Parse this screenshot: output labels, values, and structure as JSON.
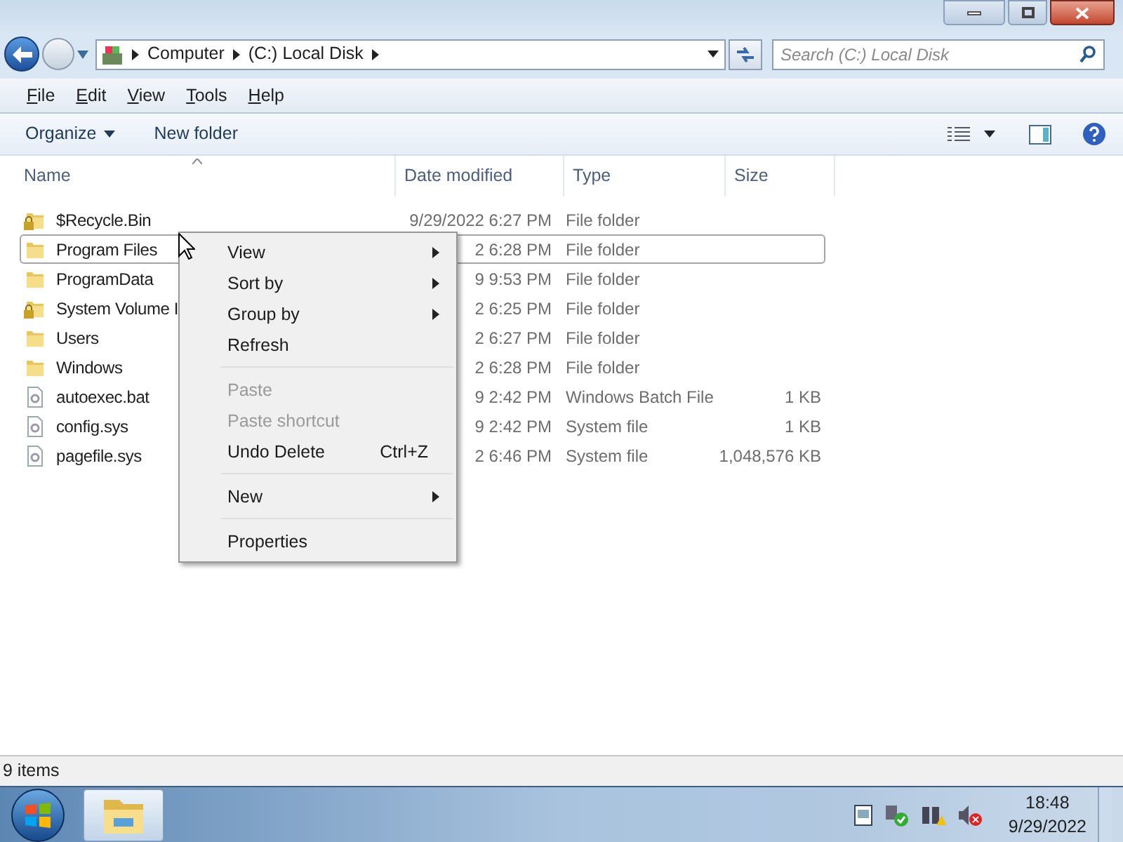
{
  "breadcrumb": [
    "Computer",
    "(C:) Local Disk"
  ],
  "search": {
    "placeholder": "Search (C:) Local Disk"
  },
  "menu_bar": [
    "File",
    "Edit",
    "View",
    "Tools",
    "Help"
  ],
  "command_bar": {
    "organize": "Organize",
    "new_folder": "New folder"
  },
  "table": {
    "columns": [
      "Name",
      "Date modified",
      "Type",
      "Size"
    ],
    "rows": [
      {
        "kind": "locked-folder",
        "name": "$Recycle.Bin",
        "date": "9/29/2022 6:27 PM",
        "type": "File folder",
        "size": "",
        "selected": false
      },
      {
        "kind": "folder",
        "name": "Program Files",
        "date": "2 6:28 PM",
        "type": "File folder",
        "size": "",
        "selected": true
      },
      {
        "kind": "folder",
        "name": "ProgramData",
        "date": "9 9:53 PM",
        "type": "File folder",
        "size": "",
        "selected": false
      },
      {
        "kind": "locked-folder",
        "name": "System Volume I",
        "date": "2 6:25 PM",
        "type": "File folder",
        "size": "",
        "selected": false
      },
      {
        "kind": "folder",
        "name": "Users",
        "date": "2 6:27 PM",
        "type": "File folder",
        "size": "",
        "selected": false
      },
      {
        "kind": "folder",
        "name": "Windows",
        "date": "2 6:28 PM",
        "type": "File folder",
        "size": "",
        "selected": false
      },
      {
        "kind": "batch",
        "name": "autoexec.bat",
        "date": "9 2:42 PM",
        "type": "Windows Batch File",
        "size": "1 KB",
        "selected": false
      },
      {
        "kind": "system",
        "name": "config.sys",
        "date": "9 2:42 PM",
        "type": "System file",
        "size": "1 KB",
        "selected": false
      },
      {
        "kind": "system",
        "name": "pagefile.sys",
        "date": "2 6:46 PM",
        "type": "System file",
        "size": "1,048,576 KB",
        "selected": false
      }
    ]
  },
  "context_menu": [
    {
      "kind": "item",
      "label": "View",
      "submenu": true,
      "disabled": false
    },
    {
      "kind": "item",
      "label": "Sort by",
      "submenu": true,
      "disabled": false
    },
    {
      "kind": "item",
      "label": "Group by",
      "submenu": true,
      "disabled": false
    },
    {
      "kind": "item",
      "label": "Refresh",
      "submenu": false,
      "disabled": false
    },
    {
      "kind": "separator"
    },
    {
      "kind": "item",
      "label": "Paste",
      "submenu": false,
      "disabled": true
    },
    {
      "kind": "item",
      "label": "Paste shortcut",
      "submenu": false,
      "disabled": true
    },
    {
      "kind": "item",
      "label": "Undo Delete",
      "shortcut": "Ctrl+Z",
      "submenu": false,
      "disabled": false
    },
    {
      "kind": "separator"
    },
    {
      "kind": "item",
      "label": "New",
      "submenu": true,
      "disabled": false
    },
    {
      "kind": "separator"
    },
    {
      "kind": "item",
      "label": "Properties",
      "submenu": false,
      "disabled": false
    }
  ],
  "status_bar": "9 items",
  "clock": {
    "time": "18:48",
    "date": "9/29/2022"
  }
}
